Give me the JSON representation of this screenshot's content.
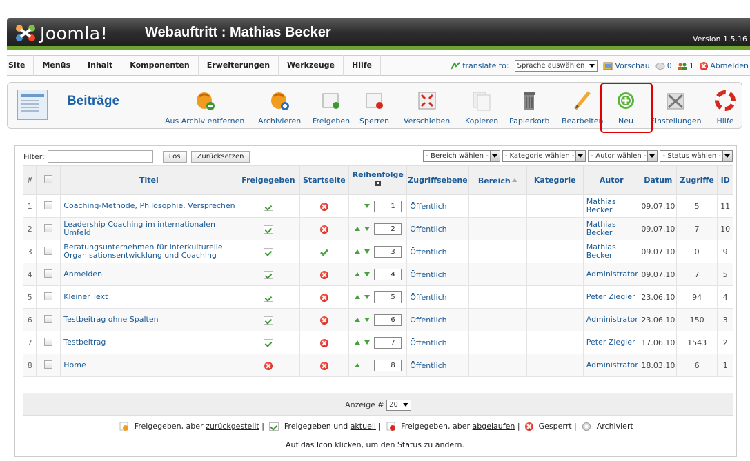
{
  "header": {
    "brand": "Joomla!",
    "site_title": "Webauftritt : Mathias Becker",
    "version": "Version 1.5.16"
  },
  "menu": {
    "items": [
      "Site",
      "Menüs",
      "Inhalt",
      "Komponenten",
      "Erweiterungen",
      "Werkzeuge",
      "Hilfe"
    ],
    "translate_label": "translate to:",
    "language_select": "Sprache auswählen",
    "preview": "Vorschau",
    "messages_count": "0",
    "users_count": "1",
    "logout": "Abmelden"
  },
  "toolbar": {
    "page_title": "Beiträge",
    "buttons": [
      "Aus Archiv entfernen",
      "Archivieren",
      "Freigeben",
      "Sperren",
      "Verschieben",
      "Kopieren",
      "Papierkorb",
      "Bearbeiten",
      "Neu",
      "Einstellungen",
      "Hilfe"
    ]
  },
  "filter": {
    "label": "Filter:",
    "value": "",
    "go": "Los",
    "reset": "Zurücksetzen",
    "selects": [
      "- Bereich wählen -",
      "- Kategorie wählen -",
      "- Autor wählen -",
      "- Status wählen -"
    ]
  },
  "table": {
    "headers": {
      "num": "#",
      "title": "Titel",
      "published": "Freigegeben",
      "frontpage": "Startseite",
      "order": "Reihenfolge",
      "access": "Zugriffsebene",
      "section": "Bereich",
      "category": "Kategorie",
      "author": "Autor",
      "date": "Datum",
      "hits": "Zugriffe",
      "id": "ID"
    },
    "rows": [
      {
        "num": "1",
        "title": "Coaching-Methode, Philosophie, Versprechen",
        "published": "published",
        "frontpage": "no",
        "up": false,
        "down": true,
        "order": "1",
        "access": "Öffentlich",
        "section": "",
        "category": "",
        "author": "Mathias Becker",
        "date": "09.07.10",
        "hits": "5",
        "id": "11"
      },
      {
        "num": "2",
        "title": "Leadership Coaching im internationalen Umfeld",
        "published": "published",
        "frontpage": "no",
        "up": true,
        "down": true,
        "order": "2",
        "access": "Öffentlich",
        "section": "",
        "category": "",
        "author": "Mathias Becker",
        "date": "09.07.10",
        "hits": "7",
        "id": "10"
      },
      {
        "num": "3",
        "title": "Beratungsunternehmen für interkulturelle Organisationsentwicklung und Coaching",
        "published": "published",
        "frontpage": "yes",
        "up": true,
        "down": true,
        "order": "3",
        "access": "Öffentlich",
        "section": "",
        "category": "",
        "author": "Mathias Becker",
        "date": "09.07.10",
        "hits": "0",
        "id": "9"
      },
      {
        "num": "4",
        "title": "Anmelden",
        "published": "published",
        "frontpage": "no",
        "up": true,
        "down": true,
        "order": "4",
        "access": "Öffentlich",
        "section": "",
        "category": "",
        "author": "Administrator",
        "date": "09.07.10",
        "hits": "7",
        "id": "5"
      },
      {
        "num": "5",
        "title": "Kleiner Text",
        "published": "published",
        "frontpage": "no",
        "up": true,
        "down": true,
        "order": "5",
        "access": "Öffentlich",
        "section": "",
        "category": "",
        "author": "Peter Ziegler",
        "date": "23.06.10",
        "hits": "94",
        "id": "4"
      },
      {
        "num": "6",
        "title": "Testbeitrag ohne Spalten",
        "published": "published",
        "frontpage": "no",
        "up": true,
        "down": true,
        "order": "6",
        "access": "Öffentlich",
        "section": "",
        "category": "",
        "author": "Administrator",
        "date": "23.06.10",
        "hits": "150",
        "id": "3"
      },
      {
        "num": "7",
        "title": "Testbeitrag",
        "published": "published",
        "frontpage": "no",
        "up": true,
        "down": true,
        "order": "7",
        "access": "Öffentlich",
        "section": "",
        "category": "",
        "author": "Peter Ziegler",
        "date": "17.06.10",
        "hits": "1543",
        "id": "2"
      },
      {
        "num": "8",
        "title": "Home",
        "published": "unpublished",
        "frontpage": "no",
        "up": true,
        "down": false,
        "order": "8",
        "access": "Öffentlich",
        "section": "",
        "category": "",
        "author": "Administrator",
        "date": "18.03.10",
        "hits": "6",
        "id": "1"
      }
    ]
  },
  "pagination": {
    "label": "Anzeige #",
    "value": "20"
  },
  "legend": {
    "pending_prefix": "Freigegeben, aber ",
    "pending_link": "zurückgestellt",
    "current_prefix": "Freigegeben und ",
    "current_link": "aktuell",
    "expired_prefix": "Freigegeben, aber ",
    "expired_link": "abgelaufen",
    "unpublished": "Gesperrt",
    "archived": "Archiviert",
    "hint": "Auf das Icon klicken, um den Status zu ändern."
  },
  "colors": {
    "link": "#1a5a96",
    "accent_green": "#6ea52f",
    "highlight": "#e00000"
  }
}
